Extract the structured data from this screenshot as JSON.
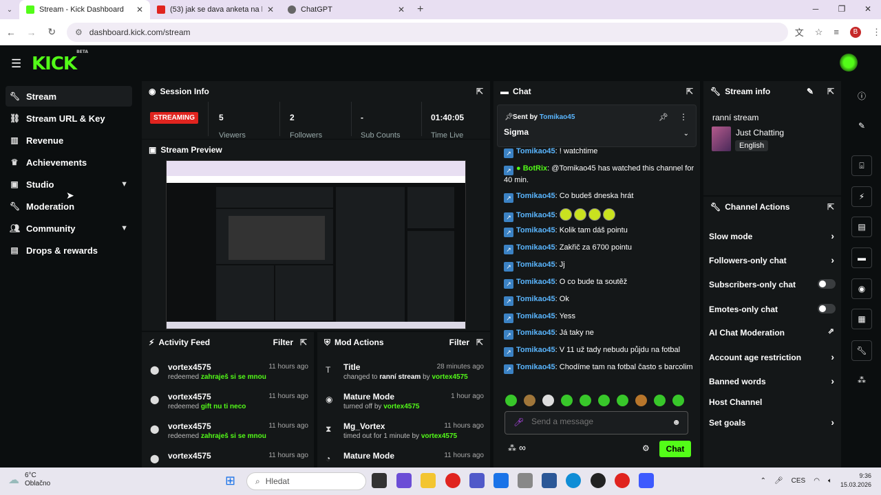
{
  "browser": {
    "tabs": [
      {
        "title": "Stream - Kick Dashboard",
        "color": "#53fc18",
        "active": true
      },
      {
        "title": "(53) jak se dava anketa na kick...",
        "color": "#e0241f",
        "active": false
      },
      {
        "title": "ChatGPT",
        "color": "#555555",
        "active": false
      }
    ],
    "url": "dashboard.kick.com/stream",
    "profile_initial": "B"
  },
  "header": {
    "logo": "KICK",
    "logo_sup": "BETA"
  },
  "sidebar": {
    "items": [
      {
        "label": "Stream",
        "icon": "wrench-icon",
        "active": true
      },
      {
        "label": "Stream URL & Key",
        "icon": "link-icon"
      },
      {
        "label": "Revenue",
        "icon": "chart-icon"
      },
      {
        "label": "Achievements",
        "icon": "trophy-icon"
      },
      {
        "label": "Studio",
        "icon": "studio-icon",
        "expandable": true
      },
      {
        "label": "Moderation",
        "icon": "wrench-icon"
      },
      {
        "label": "Community",
        "icon": "people-icon",
        "expandable": true
      },
      {
        "label": "Drops & rewards",
        "icon": "gift-icon"
      }
    ]
  },
  "session": {
    "title": "Session Info",
    "status": "STREAMING",
    "stats": [
      {
        "value": "5",
        "label": "Viewers"
      },
      {
        "value": "2",
        "label": "Followers"
      },
      {
        "value": "-",
        "label": "Sub Counts"
      },
      {
        "value": "01:40:05",
        "label": "Time Live"
      }
    ]
  },
  "preview": {
    "title": "Stream Preview"
  },
  "activity": {
    "title": "Activity Feed",
    "filter": "Filter",
    "items": [
      {
        "name": "vortex4575",
        "time": "11 hours ago",
        "action": "redeemed",
        "reward": "zahraješ si se mnou"
      },
      {
        "name": "vortex4575",
        "time": "11 hours ago",
        "action": "redeemed",
        "reward": "gift nu ti neco"
      },
      {
        "name": "vortex4575",
        "time": "11 hours ago",
        "action": "redeemed",
        "reward": "zahraješ si se mnou"
      },
      {
        "name": "vortex4575",
        "time": "11 hours ago",
        "action": "",
        "reward": ""
      }
    ]
  },
  "mod": {
    "title": "Mod Actions",
    "filter": "Filter",
    "items": [
      {
        "name": "Title",
        "time": "28 minutes ago",
        "pre": "changed to",
        "mid": "ranní stream",
        "by": "by",
        "user": "vortex4575"
      },
      {
        "name": "Mature Mode",
        "time": "1 hour ago",
        "pre": "turned off",
        "mid": "",
        "by": "by",
        "user": "vortex4575"
      },
      {
        "name": "Mg_Vortex",
        "time": "11 hours ago",
        "pre": "timed out for 1 minute",
        "mid": "",
        "by": "by",
        "user": "vortex4575"
      },
      {
        "name": "Mature Mode",
        "time": "11 hours ago",
        "pre": "",
        "mid": "",
        "by": "",
        "user": ""
      }
    ]
  },
  "chat": {
    "title": "Chat",
    "pinned": {
      "sent_by": "Sent by",
      "user": "Tomikao45",
      "message": "Sigma"
    },
    "messages": [
      {
        "user": "Tomikao45",
        "text": "! watchtime"
      },
      {
        "user": "BotRix",
        "text": "@Tomikao45 has watched this channel for 40 min.",
        "bot": true
      },
      {
        "user": "Tomikao45",
        "text": "Co budeš dneska hrát"
      },
      {
        "user": "Tomikao45",
        "text": "",
        "emotes": 4
      },
      {
        "user": "Tomikao45",
        "text": "Kolik tam dáš pointu"
      },
      {
        "user": "Tomikao45",
        "text": "Zakřič za 6700 pointu"
      },
      {
        "user": "Tomikao45",
        "text": "Jj"
      },
      {
        "user": "Tomikao45",
        "text": "O co bude ta soutěž"
      },
      {
        "user": "Tomikao45",
        "text": "Ok"
      },
      {
        "user": "Tomikao45",
        "text": "Yess"
      },
      {
        "user": "Tomikao45",
        "text": "Já taky ne"
      },
      {
        "user": "Tomikao45",
        "text": "V 11 už tady nebudu půjdu na fotbal"
      },
      {
        "user": "Tomikao45",
        "text": "Chodíme tam na fotbal často s barcolim"
      }
    ],
    "placeholder": "Send a message",
    "send": "Chat"
  },
  "stream_info": {
    "title": "Stream info",
    "stream_title": "ranní stream",
    "category": "Just Chatting",
    "language": "English"
  },
  "channel_actions": {
    "title": "Channel Actions",
    "items": [
      {
        "label": "Slow mode",
        "control": "arrow"
      },
      {
        "label": "Followers-only chat",
        "control": "arrow"
      },
      {
        "label": "Subscribers-only chat",
        "control": "toggle"
      },
      {
        "label": "Emotes-only chat",
        "control": "toggle"
      },
      {
        "label": "AI Chat Moderation",
        "control": "external"
      },
      {
        "label": "Account age restriction",
        "control": "arrow"
      },
      {
        "label": "Banned words",
        "control": "arrow"
      },
      {
        "label": "Host Channel",
        "control": "none"
      },
      {
        "label": "Set goals",
        "control": "arrow"
      }
    ]
  },
  "taskbar": {
    "temp": "6°C",
    "weather": "Oblačno",
    "search": "Hledat",
    "lang": "CES",
    "time": "9:36",
    "date": "15.03.2026"
  }
}
